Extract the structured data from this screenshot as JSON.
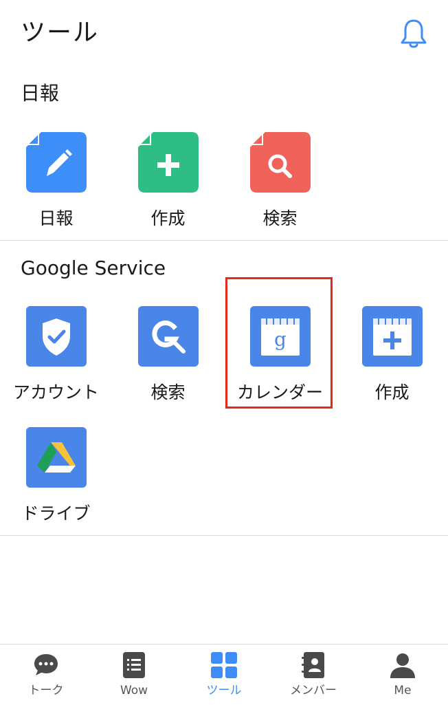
{
  "header": {
    "title": "ツール"
  },
  "sections": {
    "nippo": {
      "title": "日報",
      "items": [
        {
          "label": "日報",
          "icon": "edit-document-icon",
          "color": "#3d8ef8"
        },
        {
          "label": "作成",
          "icon": "add-document-icon",
          "color": "#2ebd84"
        },
        {
          "label": "検索",
          "icon": "search-document-icon",
          "color": "#f0625a"
        }
      ]
    },
    "google": {
      "title": "Google Service",
      "items": [
        {
          "label": "アカウント",
          "icon": "shield-check-icon",
          "color": "#4a86e8"
        },
        {
          "label": "検索",
          "icon": "google-search-icon",
          "color": "#4a86e8"
        },
        {
          "label": "カレンダー",
          "icon": "google-calendar-icon",
          "color": "#4a86e8"
        },
        {
          "label": "作成",
          "icon": "calendar-add-icon",
          "color": "#4a86e8"
        },
        {
          "label": "ドライブ",
          "icon": "google-drive-icon",
          "color": "#4a86e8"
        }
      ]
    }
  },
  "tabs": [
    {
      "label": "トーク",
      "icon": "chat-bubble-icon",
      "active": false
    },
    {
      "label": "Wow",
      "icon": "list-note-icon",
      "active": false
    },
    {
      "label": "ツール",
      "icon": "grid-icon",
      "active": true
    },
    {
      "label": "メンバー",
      "icon": "contact-book-icon",
      "active": false
    },
    {
      "label": "Me",
      "icon": "person-icon",
      "active": false
    }
  ],
  "colors": {
    "accent": "#3e8cf5",
    "highlight": "#e32a18"
  }
}
